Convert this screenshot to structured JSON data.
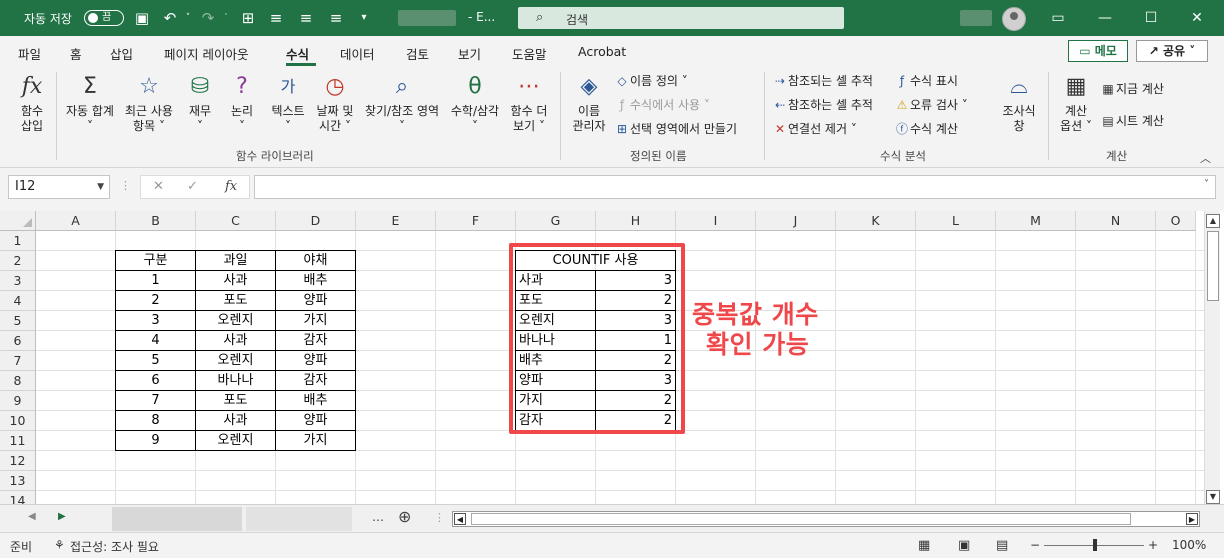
{
  "titlebar": {
    "autosave_label": "자동 저장",
    "toggle_label": "끔",
    "doc_title": "- E...",
    "search_placeholder": "검색"
  },
  "tabs": [
    "파일",
    "홈",
    "삽입",
    "페이지 레이아웃",
    "수식",
    "데이터",
    "검토",
    "보기",
    "도움말",
    "Acrobat"
  ],
  "active_tab": "수식",
  "memo_label": "메모",
  "share_label": "공유",
  "ribbon": {
    "insert_function": [
      "함수",
      "삽입"
    ],
    "autosum": [
      "자동 합계",
      "˅"
    ],
    "recent": [
      "최근 사용",
      "항목 ˅"
    ],
    "financial": [
      "재무",
      "˅"
    ],
    "logical": [
      "논리",
      "˅"
    ],
    "text": [
      "텍스트",
      "˅"
    ],
    "datetime": [
      "날짜 및",
      "시간 ˅"
    ],
    "lookup": [
      "찾기/참조 영역",
      "˅"
    ],
    "math": [
      "수학/삼각",
      "˅"
    ],
    "more": [
      "함수 더",
      "보기 ˅"
    ],
    "group_library": "함수 라이브러리",
    "name_manager": [
      "이름",
      "관리자"
    ],
    "define_name": "이름 정의 ˅",
    "use_in_formula": "수식에서 사용 ˅",
    "create_from_selection": "선택 영역에서 만들기",
    "group_defined": "정의된 이름",
    "trace_precedents": "참조되는 셀 추적",
    "trace_dependents": "참조하는 셀 추적",
    "remove_arrows": "연결선 제거 ˅",
    "show_formulas": "수식 표시",
    "error_check": "오류 검사 ˅",
    "evaluate": "수식 계산",
    "watch_window": [
      "조사식",
      "창"
    ],
    "group_audit": "수식 분석",
    "calc_options": [
      "계산",
      "옵션 ˅"
    ],
    "calc_now": "지금 계산",
    "calc_sheet": "시트 계산",
    "group_calc": "계산"
  },
  "formula_bar": {
    "name_box": "I12",
    "fx": "fx",
    "value": ""
  },
  "columns": [
    "A",
    "B",
    "C",
    "D",
    "E",
    "F",
    "G",
    "H",
    "I",
    "J",
    "K",
    "L",
    "M",
    "N",
    "O"
  ],
  "rows": [
    "1",
    "2",
    "3",
    "4",
    "5",
    "6",
    "7",
    "8",
    "9",
    "10",
    "11",
    "12",
    "13",
    "14"
  ],
  "table1": {
    "headers": [
      "구분",
      "과일",
      "야채"
    ],
    "rows": [
      [
        "1",
        "사과",
        "배추"
      ],
      [
        "2",
        "포도",
        "양파"
      ],
      [
        "3",
        "오렌지",
        "가지"
      ],
      [
        "4",
        "사과",
        "감자"
      ],
      [
        "5",
        "오렌지",
        "양파"
      ],
      [
        "6",
        "바나나",
        "감자"
      ],
      [
        "7",
        "포도",
        "배추"
      ],
      [
        "8",
        "사과",
        "양파"
      ],
      [
        "9",
        "오렌지",
        "가지"
      ]
    ]
  },
  "table2": {
    "header": "COUNTIF 사용",
    "rows": [
      [
        "사과",
        "3"
      ],
      [
        "포도",
        "2"
      ],
      [
        "오렌지",
        "3"
      ],
      [
        "바나나",
        "1"
      ],
      [
        "배추",
        "2"
      ],
      [
        "양파",
        "3"
      ],
      [
        "가지",
        "2"
      ],
      [
        "감자",
        "2"
      ]
    ]
  },
  "annotation": [
    "중복값 개수",
    "확인 가능"
  ],
  "annotation_color": "#f0474a",
  "accent_color": "#217346",
  "status": {
    "ready": "준비",
    "accessibility": "접근성: 조사 필요",
    "zoom": "100%"
  }
}
